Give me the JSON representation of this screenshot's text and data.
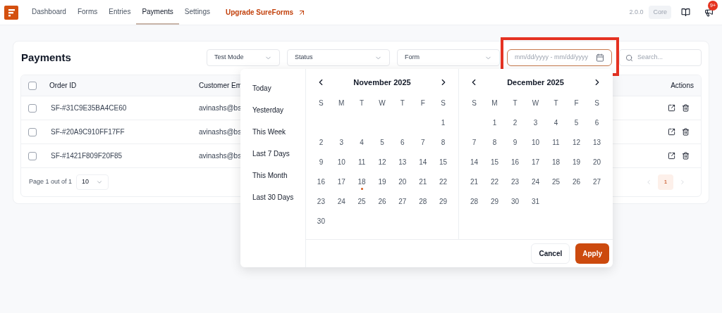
{
  "nav": {
    "items": [
      {
        "label": "Dashboard",
        "selected": false
      },
      {
        "label": "Forms",
        "selected": false
      },
      {
        "label": "Entries",
        "selected": false
      },
      {
        "label": "Payments",
        "selected": true
      },
      {
        "label": "Settings",
        "selected": false
      }
    ],
    "upgrade": "Upgrade SureForms",
    "version": "2.0.0",
    "edition": "Core",
    "notifications": "9+"
  },
  "page": {
    "title": "Payments",
    "filters": [
      {
        "kind": "select",
        "label": "Test Mode"
      },
      {
        "kind": "select",
        "label": "Status"
      },
      {
        "kind": "select",
        "label": "Form"
      },
      {
        "kind": "date",
        "placeholder": "mm/dd/yyyy - mm/dd/yyyy",
        "highlighted": true
      },
      {
        "kind": "search",
        "placeholder": "Search..."
      }
    ]
  },
  "table": {
    "columns": [
      "Order ID",
      "Customer Em",
      "Actions"
    ],
    "rows": [
      {
        "order_id": "SF-#31C9E35BA4CE60",
        "email": "avinashs@bs",
        "checked": false
      },
      {
        "order_id": "SF-#20A9C910FF17FF",
        "email": "avinashs@bs",
        "checked": false
      },
      {
        "order_id": "SF-#1421F809F20F85",
        "email": "avinashs@bs",
        "checked": false
      }
    ],
    "header_checked": false,
    "pagination": {
      "summary": "Page 1 out of 1",
      "per_page": "10",
      "pages": [
        {
          "label": "1",
          "selected": true
        }
      ]
    }
  },
  "date_picker": {
    "presets": [
      "Today",
      "Yesterday",
      "This Week",
      "Last 7 Days",
      "This Month",
      "Last 30 Days"
    ],
    "months": [
      {
        "title": "November 2025",
        "weekdays": [
          "S",
          "M",
          "T",
          "W",
          "T",
          "F",
          "S"
        ],
        "weeks": [
          [
            {
              "label": "1",
              "today": false
            }
          ],
          [
            {
              "label": "2",
              "today": false
            },
            {
              "label": "3",
              "today": false
            },
            {
              "label": "4",
              "today": false
            },
            {
              "label": "5",
              "today": false
            },
            {
              "label": "6",
              "today": false
            },
            {
              "label": "7",
              "today": false
            },
            {
              "label": "8",
              "today": false
            }
          ],
          [
            {
              "label": "9",
              "today": false
            },
            {
              "label": "10",
              "today": false
            },
            {
              "label": "11",
              "today": false
            },
            {
              "label": "12",
              "today": false
            },
            {
              "label": "13",
              "today": false
            },
            {
              "label": "14",
              "today": false
            },
            {
              "label": "15",
              "today": false
            }
          ],
          [
            {
              "label": "16",
              "today": false
            },
            {
              "label": "17",
              "today": false
            },
            {
              "label": "18",
              "today": true
            },
            {
              "label": "19",
              "today": false
            },
            {
              "label": "20",
              "today": false
            },
            {
              "label": "21",
              "today": false
            },
            {
              "label": "22",
              "today": false
            }
          ],
          [
            {
              "label": "23",
              "today": false
            },
            {
              "label": "24",
              "today": false
            },
            {
              "label": "25",
              "today": false
            },
            {
              "label": "26",
              "today": false
            },
            {
              "label": "27",
              "today": false
            },
            {
              "label": "28",
              "today": false
            },
            {
              "label": "29",
              "today": false
            }
          ],
          [
            {
              "label": "30",
              "today": false
            }
          ]
        ]
      },
      {
        "title": "December 2025",
        "weekdays": [
          "S",
          "M",
          "T",
          "W",
          "T",
          "F",
          "S"
        ],
        "weeks": [
          [
            {
              "label": "1",
              "today": false
            },
            {
              "label": "2",
              "today": false
            },
            {
              "label": "3",
              "today": false
            },
            {
              "label": "4",
              "today": false
            },
            {
              "label": "5",
              "today": false
            },
            {
              "label": "6",
              "today": false
            }
          ],
          [
            {
              "label": "7",
              "today": false
            },
            {
              "label": "8",
              "today": false
            },
            {
              "label": "9",
              "today": false
            },
            {
              "label": "10",
              "today": false
            },
            {
              "label": "11",
              "today": false
            },
            {
              "label": "12",
              "today": false
            },
            {
              "label": "13",
              "today": false
            }
          ],
          [
            {
              "label": "14",
              "today": false
            },
            {
              "label": "15",
              "today": false
            },
            {
              "label": "16",
              "today": false
            },
            {
              "label": "17",
              "today": false
            },
            {
              "label": "18",
              "today": false
            },
            {
              "label": "19",
              "today": false
            },
            {
              "label": "20",
              "today": false
            }
          ],
          [
            {
              "label": "21",
              "today": false
            },
            {
              "label": "22",
              "today": false
            },
            {
              "label": "23",
              "today": false
            },
            {
              "label": "24",
              "today": false
            },
            {
              "label": "25",
              "today": false
            },
            {
              "label": "26",
              "today": false
            },
            {
              "label": "27",
              "today": false
            }
          ],
          [
            {
              "label": "28",
              "today": false
            },
            {
              "label": "29",
              "today": false
            },
            {
              "label": "30",
              "today": false
            },
            {
              "label": "31",
              "today": false
            }
          ]
        ]
      }
    ],
    "buttons": [
      {
        "kind": "secondary",
        "label": "Cancel"
      },
      {
        "kind": "primary",
        "label": "Apply"
      }
    ]
  }
}
